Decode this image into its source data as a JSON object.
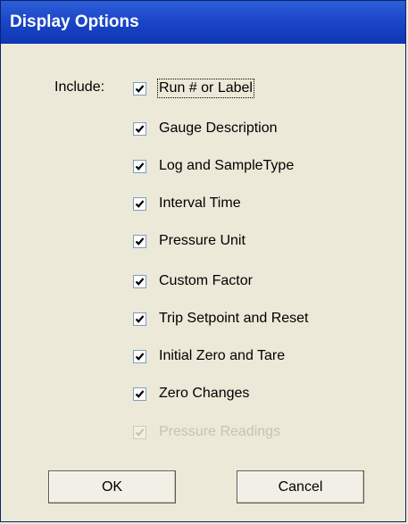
{
  "window": {
    "title": "Display Options"
  },
  "include_label": "Include:",
  "options": [
    {
      "label": "Run # or Label",
      "checked": true,
      "enabled": true
    },
    {
      "label": "Gauge Description",
      "checked": true,
      "enabled": true
    },
    {
      "label": "Log and SampleType",
      "checked": true,
      "enabled": true
    },
    {
      "label": "Interval Time",
      "checked": true,
      "enabled": true
    },
    {
      "label": "Pressure Unit",
      "checked": true,
      "enabled": true
    },
    {
      "label": "Custom Factor",
      "checked": true,
      "enabled": true
    },
    {
      "label": "Trip Setpoint and Reset",
      "checked": true,
      "enabled": true
    },
    {
      "label": "Initial Zero and Tare",
      "checked": true,
      "enabled": true
    },
    {
      "label": "Zero Changes",
      "checked": true,
      "enabled": true
    },
    {
      "label": "Pressure Readings",
      "checked": true,
      "enabled": false
    }
  ],
  "buttons": {
    "ok": "OK",
    "cancel": "Cancel"
  },
  "colors": {
    "titlebar": "#1c47c8",
    "dialog_bg": "#ece9d8",
    "disabled_text": "#c7c3b3"
  }
}
